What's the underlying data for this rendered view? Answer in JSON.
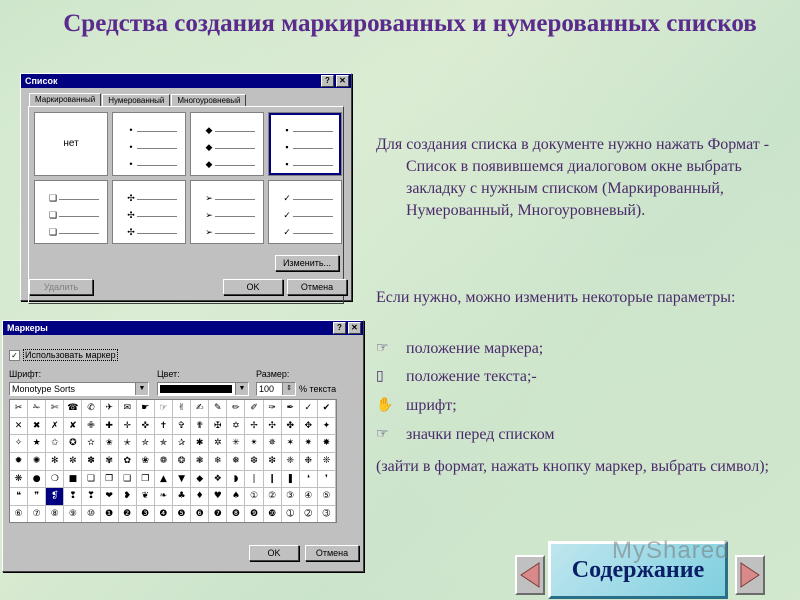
{
  "title": "Средства создания маркированных и нумерованных списков",
  "dialog1": {
    "title": "Список",
    "help_btn": "?",
    "close_btn": "✕",
    "tabs": [
      "Маркированный",
      "Нумерованный",
      "Многоуровневый"
    ],
    "cells": [
      {
        "type": "none",
        "label": "нет"
      },
      {
        "type": "list",
        "bullet": "•"
      },
      {
        "type": "list",
        "bullet": "◆"
      },
      {
        "type": "list",
        "bullet": "▪",
        "selected": true
      },
      {
        "type": "list",
        "bullet": "❑"
      },
      {
        "type": "list",
        "bullet": "✣"
      },
      {
        "type": "list",
        "bullet": "➢"
      },
      {
        "type": "list",
        "bullet": "✓"
      }
    ],
    "modify_btn": "Изменить...",
    "delete_btn": "Удалить",
    "ok_btn": "OK",
    "cancel_btn": "Отмена"
  },
  "dialog2": {
    "title": "Маркеры",
    "help_btn": "?",
    "close_btn": "✕",
    "use_marker": "Использовать маркер",
    "font_label": "Шрифт:",
    "font_value": "Monotype Sorts",
    "color_label": "Цвет:",
    "size_label": "Размер:",
    "size_value": "100",
    "size_unit": "% текста",
    "symbols": "✂✁✄☎✆✈✉☛☞✌✍✎✏✐✑✒✓✔✕✖✗✘✙✚✛✜✝✞✟✠✡✢✣✤✥✦✧★✩✪✫✬✭✮✯✰✱✲✳✴✵✶✷✸✹✺✻✼✽✾✿❀❁❂❃❄❅❆❇❈❉❊❋●❍■❏❐❑❒▲▼◆❖◗❘❙❚❛❜❝❞❡❢❣❤❥❦❧♣♦♥♠①②③④⑤⑥⑦⑧⑨⑩❶❷❸❹❺❻❼❽❾❿➀➁➂➃➄➅➆➇➈➉➊➋➌➍➎➏➐➑➒➓➔→↔↕➘➙➚➛➜➝➞➟➠➡➢➣➤➥➦➧➨➩➪➫➬➭➮➯➱➲➳➴➵➶➷➸➹➺➻➼➽➾",
    "selected_index": 92,
    "ok_btn": "OK",
    "cancel_btn": "Отмена"
  },
  "body": {
    "para1": "Для создания списка в документе нужно нажать Формат - Список в появившемся диалоговом окне выбрать закладку с нужным списком (Маркированный, Нумерованный, Многоуровневый).",
    "para2": "Если нужно, можно изменить некоторые параметры:",
    "bullets": [
      {
        "icon": "☞",
        "text": "положение маркера;"
      },
      {
        "icon": "▯",
        "text": "положение текста;-"
      },
      {
        "icon": "✋",
        "text": "шрифт;"
      },
      {
        "icon": "☞",
        "text": "значки перед списком"
      }
    ],
    "para3": "(зайти в формат, нажать кнопку маркер, выбрать символ);"
  },
  "nav": {
    "content_label": "Содержание",
    "watermark": "MyShared"
  }
}
